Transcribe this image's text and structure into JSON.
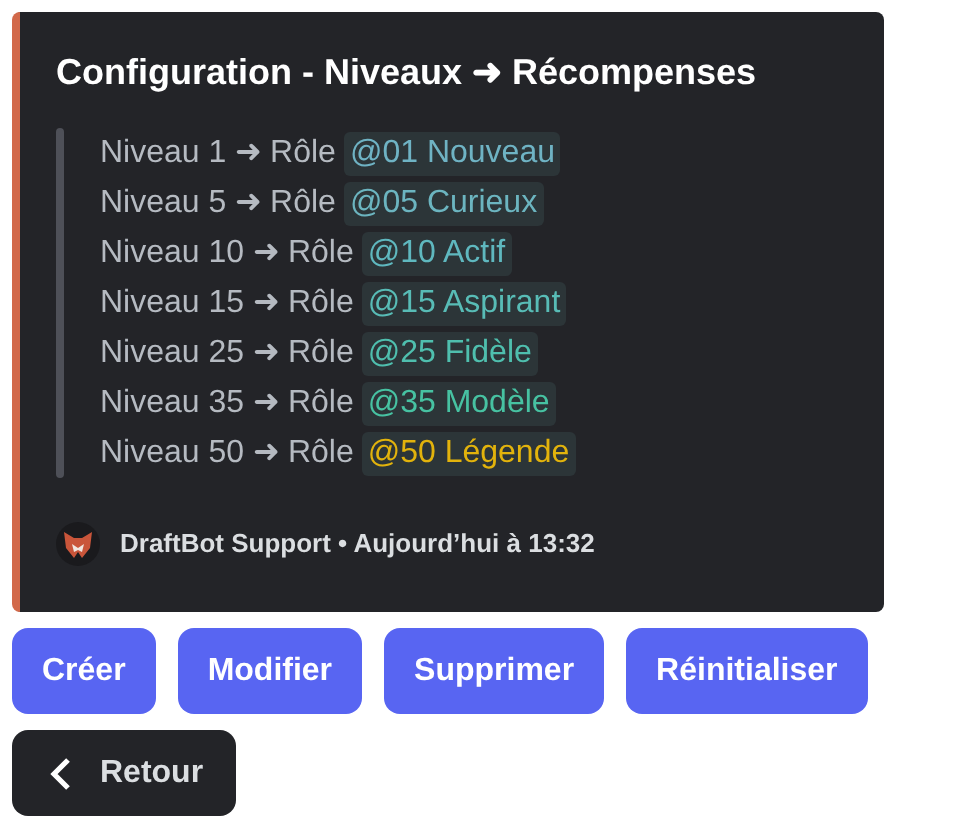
{
  "embed": {
    "title": "Configuration - Niveaux ➜ Récompenses",
    "rows": [
      {
        "level_text": "Niveau 1 ➜ Rôle",
        "role": "@01 Nouveau",
        "color": "#6fb3c4"
      },
      {
        "level_text": "Niveau 5 ➜ Rôle",
        "role": "@05 Curieux",
        "color": "#6cb5c0"
      },
      {
        "level_text": "Niveau 10 ➜ Rôle",
        "role": "@10 Actif",
        "color": "#5fb8bf"
      },
      {
        "level_text": "Niveau 15 ➜ Rôle",
        "role": "@15 Aspirant",
        "color": "#58bcb6"
      },
      {
        "level_text": "Niveau 25 ➜ Rôle",
        "role": "@25 Fidèle",
        "color": "#4fbfae"
      },
      {
        "level_text": "Niveau 35 ➜ Rôle",
        "role": "@35 Modèle",
        "color": "#47c2a2"
      },
      {
        "level_text": "Niveau 50 ➜ Rôle",
        "role": "@50 Légende",
        "color": "#e2b30c"
      }
    ],
    "footer": "DraftBot Support • Aujourd’hui à 13:32"
  },
  "buttons": [
    {
      "label": "Créer",
      "kind": "primary"
    },
    {
      "label": "Modifier",
      "kind": "primary"
    },
    {
      "label": "Supprimer",
      "kind": "primary"
    },
    {
      "label": "Réinitialiser",
      "kind": "primary"
    }
  ],
  "back_button": {
    "label": "Retour",
    "kind": "secondary"
  }
}
